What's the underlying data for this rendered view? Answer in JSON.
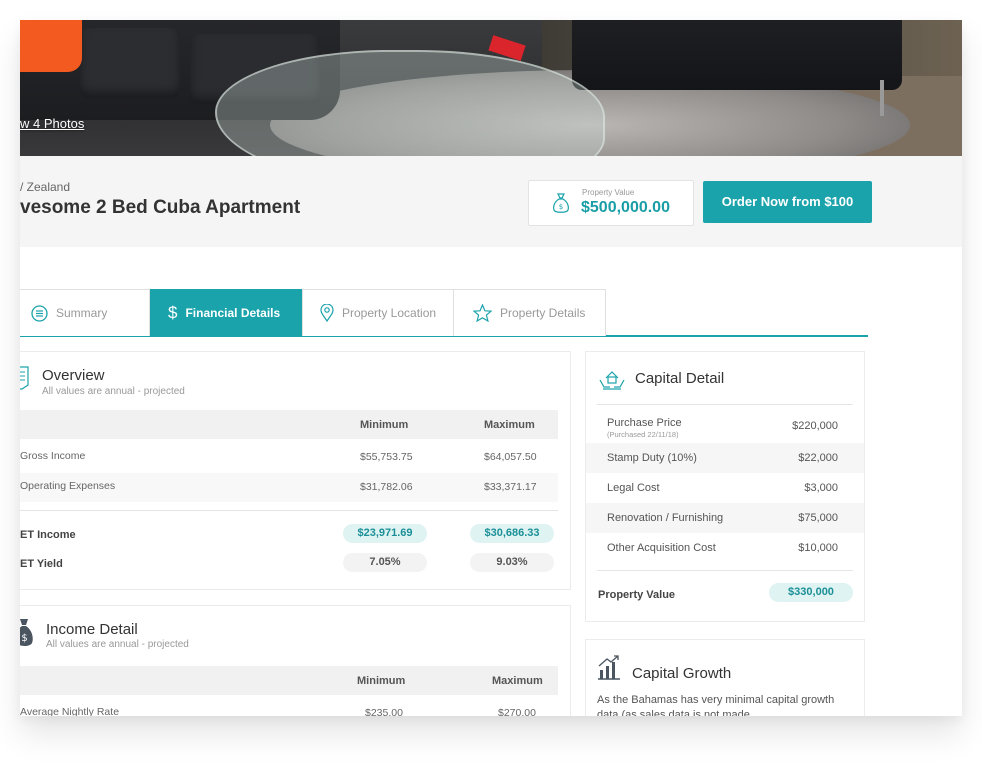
{
  "hero": {
    "view_photos": "w 4 Photos"
  },
  "header": {
    "location": "/ Zealand",
    "title": "vesome 2 Bed Cuba Apartment",
    "value_label": "Property Value",
    "value_amount": "$500,000.00",
    "order_button": "Order Now from $100"
  },
  "tabs": [
    {
      "label": "Summary",
      "icon": "list-circle-icon",
      "active": false
    },
    {
      "label": "Financial Details",
      "icon": "dollar-icon",
      "active": true
    },
    {
      "label": "Property Location",
      "icon": "map-pin-icon",
      "active": false
    },
    {
      "label": "Property Details",
      "icon": "star-icon",
      "active": false
    }
  ],
  "overview": {
    "title": "Overview",
    "subtitle": "All values are annual - projected",
    "columns": [
      "Minimum",
      "Maximum"
    ],
    "rows": [
      {
        "label": "Gross Income",
        "min": "$55,753.75",
        "max": "$64,057.50"
      },
      {
        "label": "Operating Expenses",
        "min": "$31,782.06",
        "max": "$33,371.17"
      }
    ],
    "net_income": {
      "label": "ET Income",
      "min": "$23,971.69",
      "max": "$30,686.33"
    },
    "net_yield": {
      "label": "ET Yield",
      "min": "7.05%",
      "max": "9.03%"
    }
  },
  "income": {
    "title": "Income Detail",
    "subtitle": "All values are annual - projected",
    "columns": [
      "Minimum",
      "Maximum"
    ],
    "rows": [
      {
        "label": "Average Nightly Rate",
        "min": "$235.00",
        "max": "$270.00"
      }
    ]
  },
  "capital": {
    "title": "Capital Detail",
    "rows": [
      {
        "label": "Purchase Price",
        "sub": "(Purchased 22/11/18)",
        "value": "$220,000"
      },
      {
        "label": "Stamp Duty (10%)",
        "value": "$22,000"
      },
      {
        "label": "Legal Cost",
        "value": "$3,000"
      },
      {
        "label": "Renovation / Furnishing",
        "value": "$75,000"
      },
      {
        "label": "Other Acquisition Cost",
        "value": "$10,000"
      }
    ],
    "total_label": "Property Value",
    "total_value": "$330,000"
  },
  "growth": {
    "title": "Capital Growth",
    "text": "As the Bahamas has very minimal capital growth data (as sales data is not made"
  },
  "colors": {
    "accent": "#1ba3ac",
    "pill_bg": "#dff3f2"
  }
}
